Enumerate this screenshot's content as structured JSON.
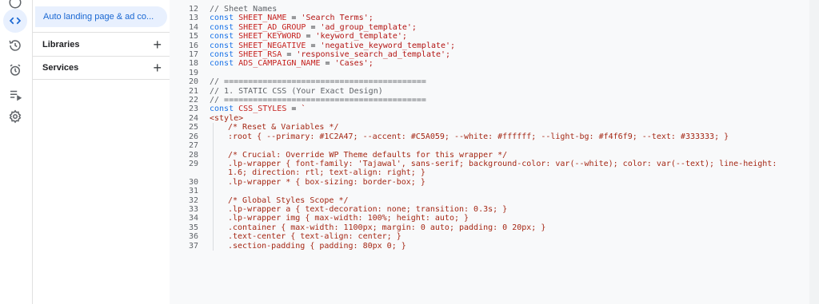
{
  "sidebar": {
    "icons": [
      "info-icon",
      "code-icon",
      "history-icon",
      "trigger-icon",
      "executions-icon",
      "settings-icon"
    ]
  },
  "files": {
    "active_file": "Auto landing page & ad co...",
    "libraries_label": "Libraries",
    "services_label": "Services",
    "plus": "+"
  },
  "editor": {
    "lines": [
      {
        "n": "12",
        "t": "// Sheet Names"
      },
      {
        "n": "13",
        "t": "const SHEET_NAME = 'Search Terms';"
      },
      {
        "n": "14",
        "t": "const SHEET_AD_GROUP = 'ad_group_template';"
      },
      {
        "n": "15",
        "t": "const SHEET_KEYWORD = 'keyword_template';"
      },
      {
        "n": "16",
        "t": "const SHEET_NEGATIVE = 'negative_keyword_template';"
      },
      {
        "n": "17",
        "t": "const SHEET_RSA = 'responsive_search_ad_template';"
      },
      {
        "n": "18",
        "t": "const ADS_CAMPAIGN_NAME = 'Cases';"
      },
      {
        "n": "19",
        "t": ""
      },
      {
        "n": "20",
        "t": "// =========================================="
      },
      {
        "n": "21",
        "t": "// 1. STATIC CSS (Your Exact Design)"
      },
      {
        "n": "22",
        "t": "// =========================================="
      },
      {
        "n": "23",
        "t": "const CSS_STYLES = `"
      },
      {
        "n": "24",
        "t": "<style>"
      },
      {
        "n": "25",
        "t": "/* Reset & Variables */"
      },
      {
        "n": "26",
        "t": ":root { --primary: #1C2A47; --accent: #C5A059; --white: #ffffff; --light-bg: #f4f6f9; --text: #333333; }"
      },
      {
        "n": "27",
        "t": ""
      },
      {
        "n": "28",
        "t": "/* Crucial: Override WP Theme defaults for this wrapper */"
      },
      {
        "n": "29",
        "t": ".lp-wrapper { font-family: 'Tajawal', sans-serif; background-color: var(--white); color: var(--text); line-height: 1.6; direction: rtl; text-align: right; }"
      },
      {
        "n": "30",
        "t": ".lp-wrapper * { box-sizing: border-box; }"
      },
      {
        "n": "31",
        "t": ""
      },
      {
        "n": "32",
        "t": "/* Global Styles Scope */"
      },
      {
        "n": "33",
        "t": ".lp-wrapper a { text-decoration: none; transition: 0.3s; }"
      },
      {
        "n": "34",
        "t": ".lp-wrapper img { max-width: 100%; height: auto; }"
      },
      {
        "n": "35",
        "t": ".container { max-width: 1100px; margin: 0 auto; padding: 0 20px; }"
      },
      {
        "n": "36",
        "t": ".text-center { text-align: center; }"
      },
      {
        "n": "37",
        "t": ".section-padding { padding: 80px 0; }"
      }
    ]
  }
}
